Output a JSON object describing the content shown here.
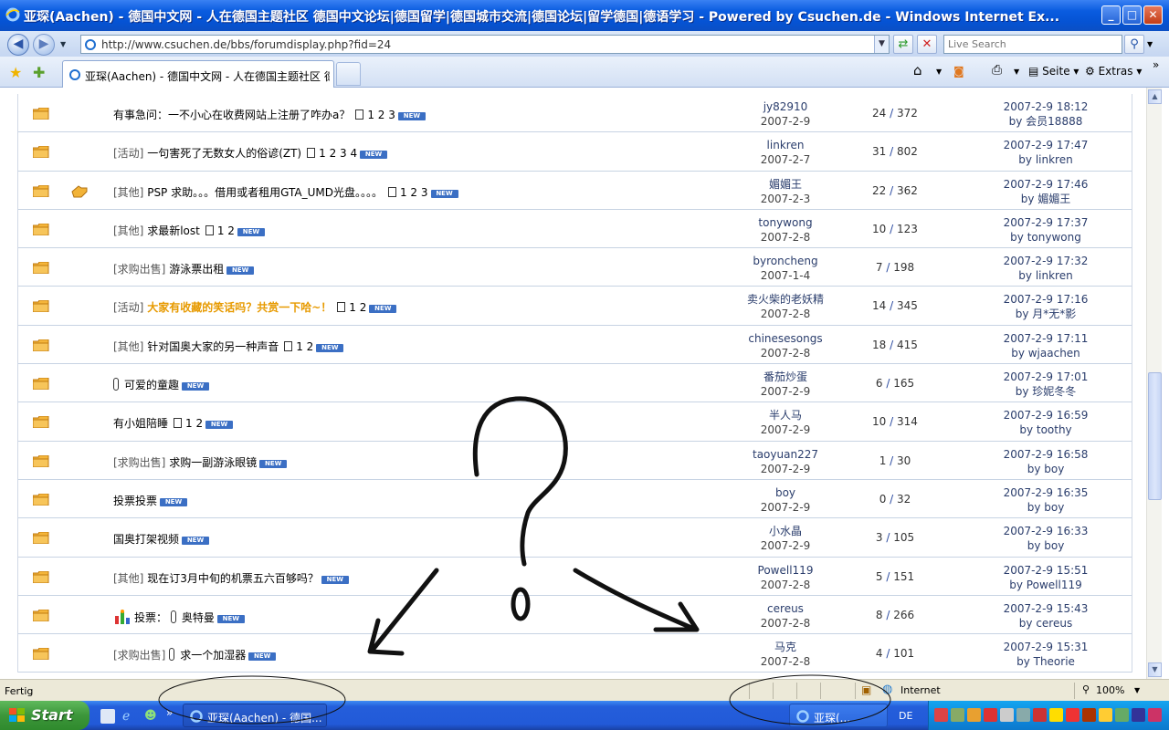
{
  "window": {
    "title": "亚琛(Aachen) - 德国中文网 - 人在德国主题社区 德国中文论坛|德国留学|德国城市交流|德国论坛|留学德国|德语学习 - Powered by Csuchen.de - Windows Internet Ex...",
    "minimize": "_",
    "maximize": "□",
    "close": "✕"
  },
  "address": {
    "back": "◀",
    "forward": "▶",
    "url": "http://www.csuchen.de/bbs/forumdisplay.php?fid=24",
    "search_placeholder": "Live Search"
  },
  "tabs": {
    "active_label": "亚琛(Aachen) - 德国中文网 - 人在德国主题社区 德...",
    "commands": [
      "Seite",
      "Extras"
    ]
  },
  "threads": [
    {
      "prefix": "",
      "title": "有事急问：一不小心在收费网站上注册了咋办a？",
      "pages": "1 2 3",
      "new": true,
      "author": "jy82910",
      "date": "2007-2-9",
      "replies": "24",
      "views": "372",
      "last_time": "2007-2-9 18:12",
      "last_by": "by 会员18888"
    },
    {
      "prefix": "[活动]",
      "title": "一句害死了无数女人的俗谚(ZT)",
      "pages": "1 2 3 4",
      "new": true,
      "author": "linkren",
      "date": "2007-2-7",
      "replies": "31",
      "views": "802",
      "last_time": "2007-2-9 17:47",
      "last_by": "by linkren"
    },
    {
      "prefix": "[其他]",
      "title": "PSP 求助。。。借用或者租用GTA_UMD光盘。。。。",
      "pages": "1 2 3",
      "new": true,
      "author": "媚媚王",
      "date": "2007-2-3",
      "replies": "22",
      "views": "362",
      "last_time": "2007-2-9 17:46",
      "last_by": "by 媚媚王"
    },
    {
      "prefix": "[其他]",
      "title": "求最新lost",
      "pages": "1 2",
      "new": true,
      "author": "tonywong",
      "date": "2007-2-8",
      "replies": "10",
      "views": "123",
      "last_time": "2007-2-9 17:37",
      "last_by": "by tonywong"
    },
    {
      "prefix": "[求购出售]",
      "title": "游泳票出租",
      "pages": "",
      "new": true,
      "author": "byroncheng",
      "date": "2007-1-4",
      "replies": "7",
      "views": "198",
      "last_time": "2007-2-9 17:32",
      "last_by": "by linkren"
    },
    {
      "prefix": "[活动]",
      "title": "大家有收藏的笑话吗？共赏一下哈~！",
      "pages": "1 2",
      "new": true,
      "author": "卖火柴的老妖精",
      "date": "2007-2-8",
      "replies": "14",
      "views": "345",
      "last_time": "2007-2-9 17:16",
      "last_by": "by 月*无*影"
    },
    {
      "prefix": "[其他]",
      "title": "针对国奥大家的另一种声音",
      "pages": "1 2",
      "new": true,
      "author": "chinesesongs",
      "date": "2007-2-8",
      "replies": "18",
      "views": "415",
      "last_time": "2007-2-9 17:11",
      "last_by": "by wjaachen"
    },
    {
      "prefix": "",
      "title": "可爱的童趣",
      "pages": "",
      "new": true,
      "author": "番茄炒蛋",
      "date": "2007-2-9",
      "replies": "6",
      "views": "165",
      "last_time": "2007-2-9 17:01",
      "last_by": "by 珍妮冬冬"
    },
    {
      "prefix": "",
      "title": "有小姐陪睡",
      "pages": "1 2",
      "new": true,
      "author": "半人马",
      "date": "2007-2-9",
      "replies": "10",
      "views": "314",
      "last_time": "2007-2-9 16:59",
      "last_by": "by toothy"
    },
    {
      "prefix": "[求购出售]",
      "title": "求购一副游泳眼镜",
      "pages": "",
      "new": true,
      "author": "taoyuan227",
      "date": "2007-2-9",
      "replies": "1",
      "views": "30",
      "last_time": "2007-2-9 16:58",
      "last_by": "by boy"
    },
    {
      "prefix": "",
      "title": "投票投票",
      "pages": "",
      "new": true,
      "author": "boy",
      "date": "2007-2-9",
      "replies": "0",
      "views": "32",
      "last_time": "2007-2-9 16:35",
      "last_by": "by boy"
    },
    {
      "prefix": "",
      "title": "国奥打架视频",
      "pages": "",
      "new": true,
      "author": "小水晶",
      "date": "2007-2-9",
      "replies": "3",
      "views": "105",
      "last_time": "2007-2-9 16:33",
      "last_by": "by boy"
    },
    {
      "prefix": "[其他]",
      "title": "现在订3月中旬的机票五六百够吗？",
      "pages": "",
      "new": true,
      "author": "Powell119",
      "date": "2007-2-8",
      "replies": "5",
      "views": "151",
      "last_time": "2007-2-9 15:51",
      "last_by": "by Powell119"
    },
    {
      "prefix": "投票：",
      "title": "奥特曼",
      "pages": "",
      "new": true,
      "author": "cereus",
      "date": "2007-2-8",
      "replies": "8",
      "views": "266",
      "last_time": "2007-2-9 15:43",
      "last_by": "by cereus"
    },
    {
      "prefix": "[求购出售]",
      "title": "求一个加湿器",
      "pages": "",
      "new": true,
      "author": "马克",
      "date": "2007-2-8",
      "replies": "4",
      "views": "101",
      "last_time": "2007-2-9 15:31",
      "last_by": "by Theorie"
    }
  ],
  "new_badge": "NEW",
  "statusbar": {
    "status": "Fertig",
    "zone": "Internet",
    "zoom": "100%"
  },
  "taskbar": {
    "start": "Start",
    "task1": "亚琛(Aachen) - 德国...",
    "task2": "亚琛(...",
    "lang": "DE"
  },
  "colors": {
    "title_blue": "#0553d4",
    "highlight_orange": "#e79a00",
    "link_blue": "#2a3d6c",
    "start_green": "#3c963a"
  }
}
